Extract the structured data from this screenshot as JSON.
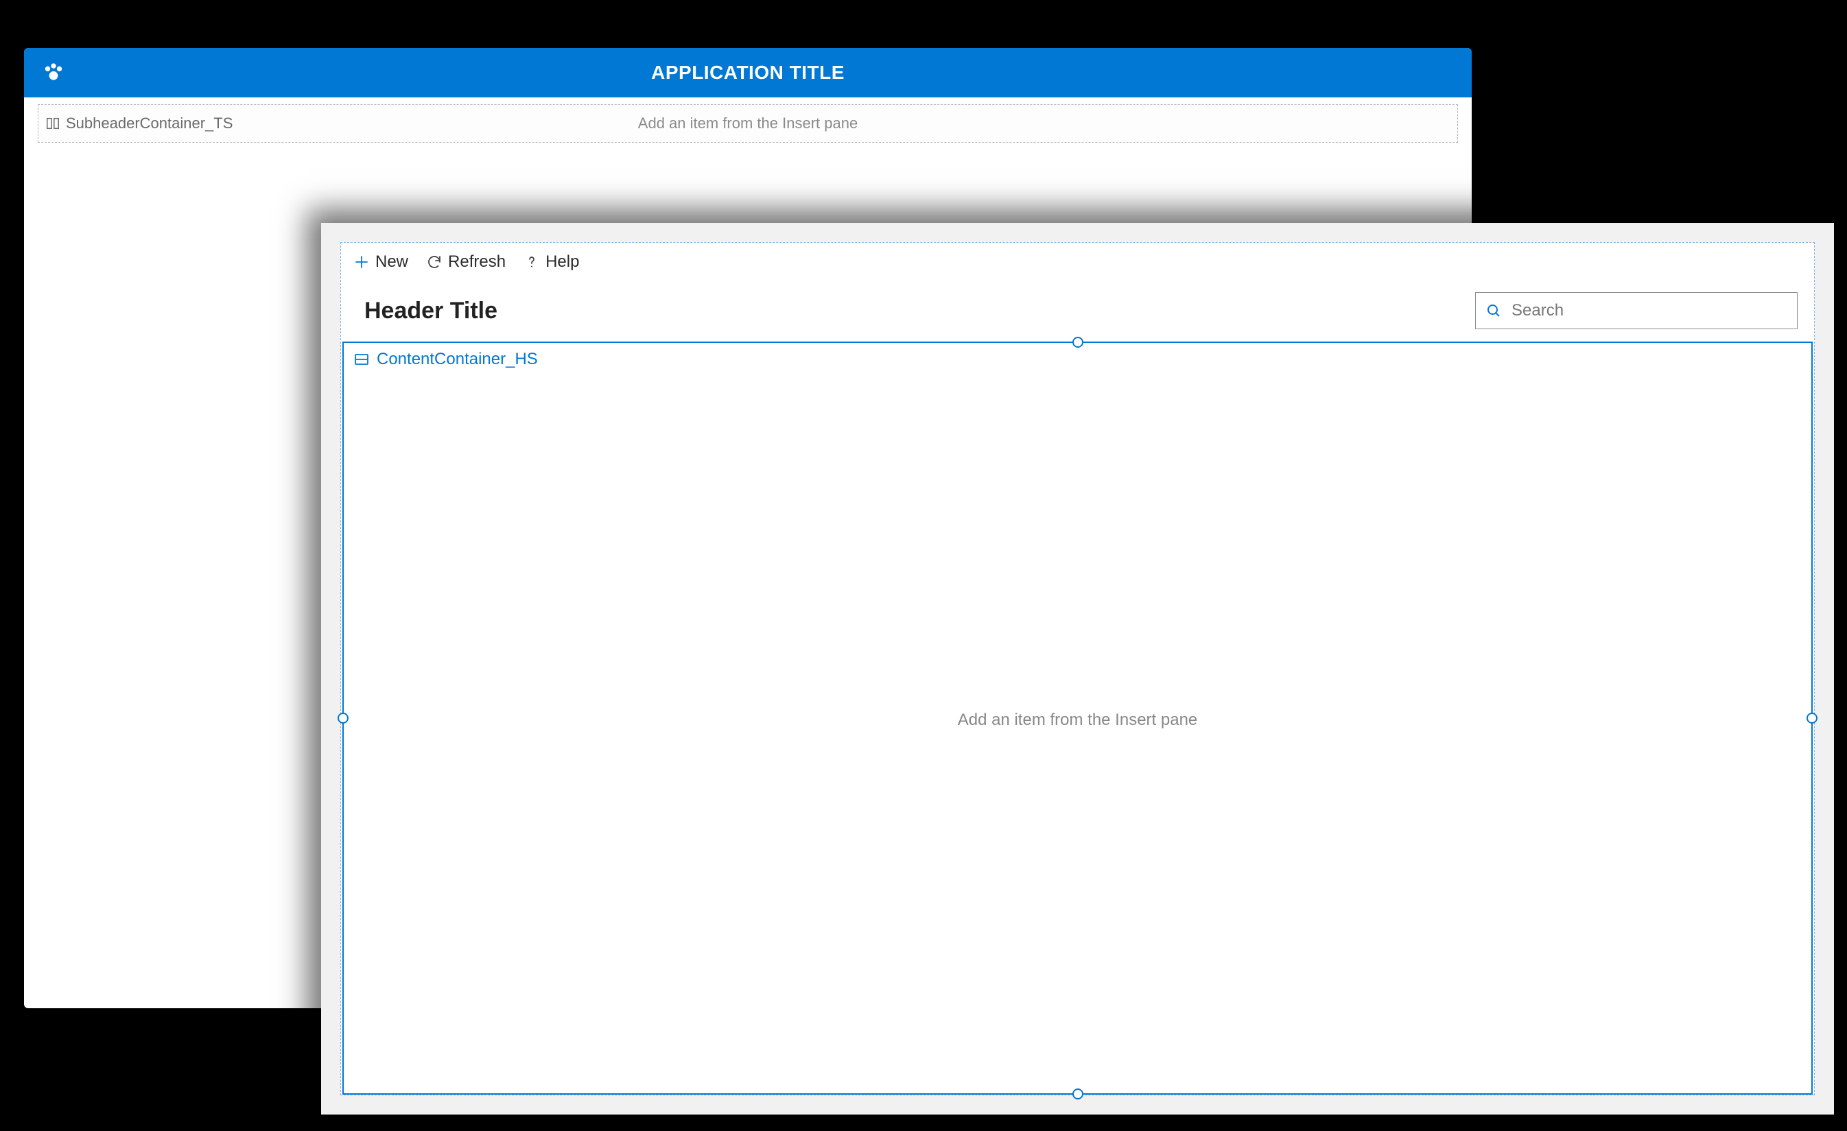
{
  "colors": {
    "brand": "#0078d4"
  },
  "backWindow": {
    "title": "APPLICATION TITLE",
    "subheader": {
      "controlName": "SubheaderContainer_TS",
      "hint": "Add an item from the Insert pane"
    }
  },
  "frontWindow": {
    "cmdBar": {
      "new": "New",
      "refresh": "Refresh",
      "help": "Help"
    },
    "headerTitle": "Header Title",
    "search": {
      "placeholder": "Search",
      "value": ""
    },
    "contentContainer": {
      "controlName": "ContentContainer_HS",
      "hint": "Add an item from the Insert pane"
    }
  }
}
